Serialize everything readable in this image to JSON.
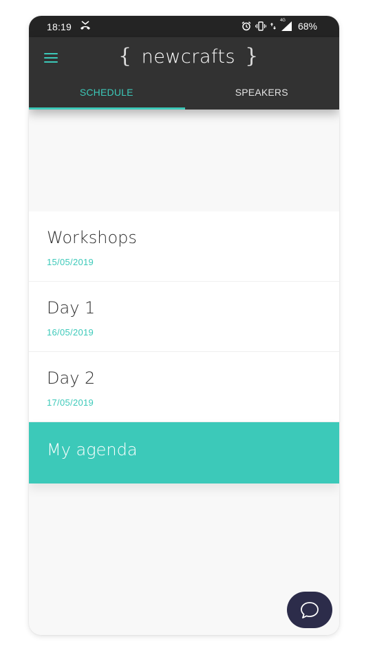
{
  "status_bar": {
    "time": "18:19",
    "network_label": "4G",
    "battery": "68%",
    "icons": [
      "missed-call-icon",
      "alarm-icon",
      "vibrate-icon",
      "data-arrows-icon",
      "signal-icon"
    ]
  },
  "app_bar": {
    "logo_open_brace": "{",
    "logo_text": "newcrafts",
    "logo_close_brace": "}",
    "menu_icon": "hamburger-menu-icon"
  },
  "tabs": [
    {
      "label": "SCHEDULE",
      "active": true
    },
    {
      "label": "SPEAKERS",
      "active": false
    }
  ],
  "schedule": {
    "days": [
      {
        "title": "Workshops",
        "date": "15/05/2019"
      },
      {
        "title": "Day 1",
        "date": "16/05/2019"
      },
      {
        "title": "Day 2",
        "date": "17/05/2019"
      }
    ],
    "agenda_label": "My agenda"
  },
  "chat_fab": {
    "icon": "chat-bubble-icon"
  },
  "colors": {
    "accent": "#3cc9b9",
    "app_bar": "#323232",
    "status_bar": "#242424",
    "fab": "#2c2c4a",
    "background": "#f8f8f8"
  }
}
